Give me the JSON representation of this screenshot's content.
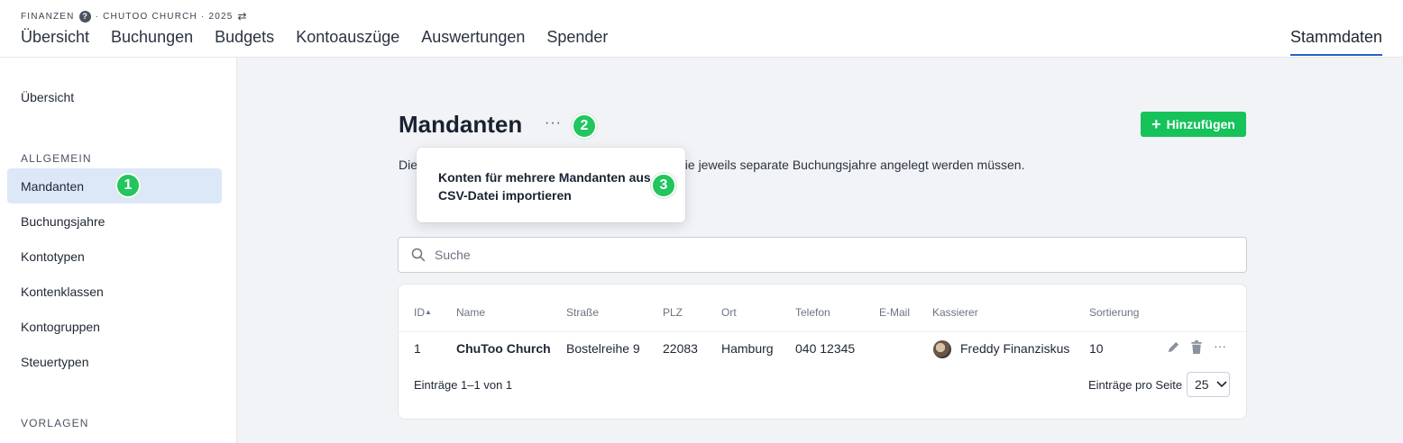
{
  "header": {
    "module": "FINANZEN",
    "org_year": "· CHUTOO CHURCH · 2025",
    "help_glyph": "?",
    "swap_glyph": "⇄",
    "nav": [
      "Übersicht",
      "Buchungen",
      "Budgets",
      "Kontoauszüge",
      "Auswertungen",
      "Spender"
    ],
    "nav_right": "Stammdaten"
  },
  "sidebar": {
    "overview": "Übersicht",
    "section_general": "ALLGEMEIN",
    "items": [
      "Mandanten",
      "Buchungsjahre",
      "Kontotypen",
      "Kontenklassen",
      "Kontogruppen",
      "Steuertypen"
    ],
    "section_templates": "VORLAGEN"
  },
  "steps": [
    "1",
    "2",
    "3"
  ],
  "main": {
    "title": "Mandanten",
    "more_glyph": "···",
    "add_button": "Hinzufügen",
    "desc_left": "Die",
    "desc_right": "die jeweils separate Buchungsjahre angelegt werden müssen.",
    "dropdown_item": "Konten für mehrere Mandanten aus CSV-Datei importieren",
    "search_placeholder": "Suche"
  },
  "table": {
    "columns": [
      "ID",
      "Name",
      "Straße",
      "PLZ",
      "Ort",
      "Telefon",
      "E-Mail",
      "Kassierer",
      "Sortierung"
    ],
    "sort_glyph": "▲",
    "rows": [
      {
        "id": "1",
        "name": "ChuToo Church",
        "street": "Bostelreihe 9",
        "zip": "22083",
        "city": "Hamburg",
        "phone": "040 12345",
        "email": "",
        "cashier": "Freddy Finanziskus",
        "sort": "10"
      }
    ],
    "footer_left": "Einträge 1–1 von 1",
    "per_page_label": "Einträge pro Seite",
    "per_page_value": "25"
  },
  "colors": {
    "accent": "#2563c9",
    "success": "#16c25a",
    "active_bg": "#dce8f8"
  }
}
